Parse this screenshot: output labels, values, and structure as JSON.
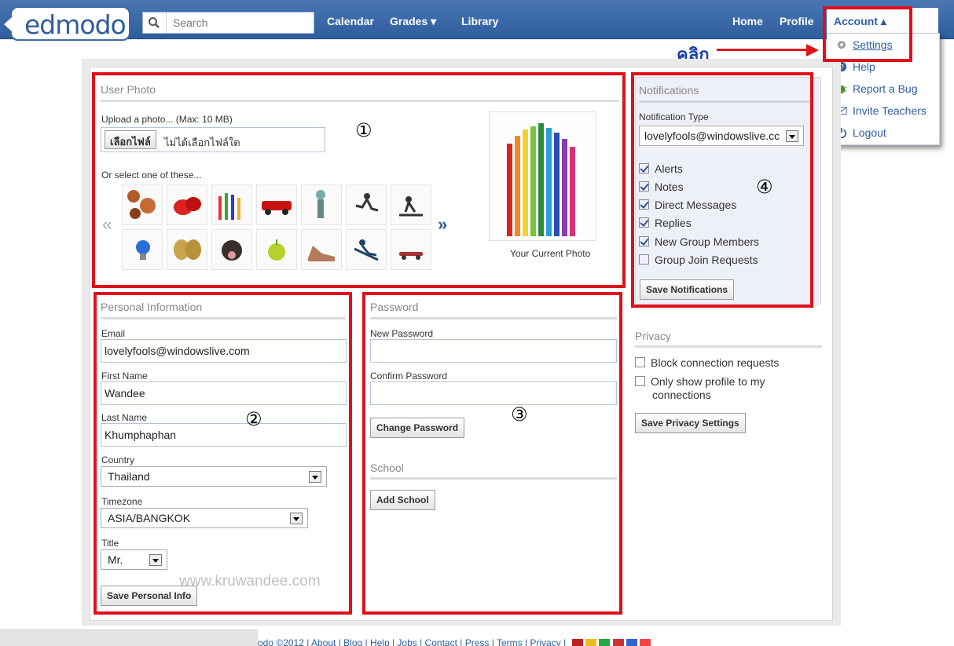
{
  "topbar": {
    "logo": "edmodo",
    "search_placeholder": "Search",
    "nav": [
      "Calendar",
      "Grades ▾",
      "Library"
    ],
    "right_nav": [
      "Home",
      "Profile"
    ],
    "account": "Account ▴"
  },
  "account_menu": {
    "items": [
      {
        "label": "Settings",
        "icon": "gear-icon"
      },
      {
        "label": "Help",
        "icon": "help-icon"
      },
      {
        "label": "Report a Bug",
        "icon": "bug-icon"
      },
      {
        "label": "Invite Teachers",
        "icon": "mail-icon"
      },
      {
        "label": "Logout",
        "icon": "power-icon"
      }
    ]
  },
  "annotation": {
    "click_label": "คลิก"
  },
  "user_photo": {
    "title": "User Photo",
    "upload_label": "Upload a photo... (Max: 10 MB)",
    "choose_button": "เลือกไฟล์",
    "no_file": "ไม่ได้เลือกไฟล์ใด",
    "select_label": "Or select one of these...",
    "prev": "«",
    "next": "»",
    "current_caption": "Your Current Photo",
    "marker": "①"
  },
  "personal": {
    "title": "Personal Information",
    "email_label": "Email",
    "email": "lovelyfools@windowslive.com",
    "first_label": "First Name",
    "first": "Wandee",
    "last_label": "Last Name",
    "last": "Khumphaphan",
    "country_label": "Country",
    "country": "Thailand",
    "timezone_label": "Timezone",
    "timezone": "ASIA/BANGKOK",
    "title_label": "Title",
    "title_value": "Mr.",
    "save": "Save Personal Info",
    "marker": "②"
  },
  "password": {
    "title": "Password",
    "new_label": "New Password",
    "confirm_label": "Confirm Password",
    "change": "Change Password",
    "school_title": "School",
    "add_school": "Add School",
    "marker": "③"
  },
  "notifications": {
    "title": "Notifications",
    "type_label": "Notification Type",
    "type_value": "lovelyfools@windowslive.cc",
    "options": [
      {
        "label": "Alerts",
        "checked": true
      },
      {
        "label": "Notes",
        "checked": true
      },
      {
        "label": "Direct Messages",
        "checked": true
      },
      {
        "label": "Replies",
        "checked": true
      },
      {
        "label": "New Group Members",
        "checked": true
      },
      {
        "label": "Group Join Requests",
        "checked": false
      }
    ],
    "save": "Save Notifications",
    "marker": "④"
  },
  "privacy": {
    "title": "Privacy",
    "block": "Block connection requests",
    "only_show_1": "Only show profile to my",
    "only_show_2": "connections",
    "save": "Save Privacy Settings"
  },
  "watermark": "www.kruwandee.com",
  "footer": "odo ©2012 | About | Blog | Help | Jobs | Contact | Press | Terms | Privacy |",
  "colors": {
    "brand": "#2f5d9d",
    "annotation_red": "#e0101a"
  }
}
